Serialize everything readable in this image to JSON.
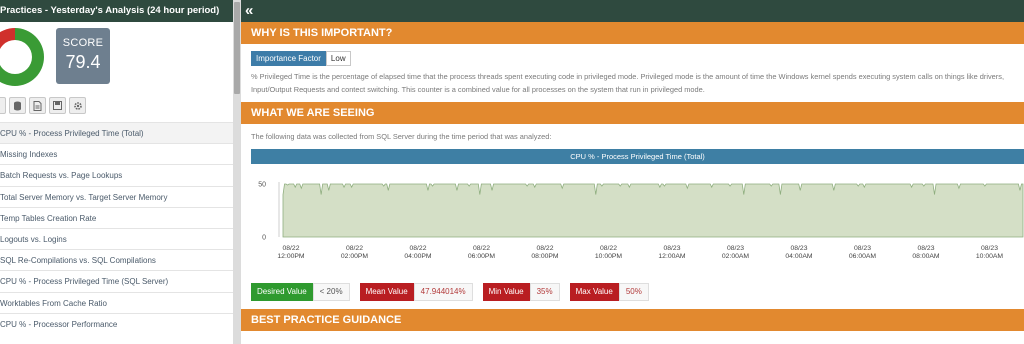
{
  "left_panel": {
    "header": "Practices - Yesterday's Analysis (24 hour period)",
    "score_label": "SCORE",
    "score_value": "79.4",
    "donut_colors": [
      "#3a9b35",
      "#e6b800",
      "#d0302c"
    ],
    "toolbar_icons": [
      "list-icon",
      "database-icon",
      "document-icon",
      "save-icon",
      "gear-icon"
    ],
    "practices": [
      "CPU % - Process Privileged Time (Total)",
      "Missing Indexes",
      "Batch Requests vs. Page Lookups",
      "Total Server Memory vs. Target Server Memory",
      "Temp Tables Creation Rate",
      "Logouts vs. Logins",
      "SQL Re-Compilations vs. SQL Compilations",
      "CPU % - Process Privileged Time (SQL Server)",
      "Worktables From Cache Ratio",
      "CPU % - Processor Performance"
    ]
  },
  "right_panel": {
    "why_header": "WHY IS THIS IMPORTANT?",
    "importance_label": "Importance Factor",
    "importance_value": "Low",
    "why_text": "% Privileged Time is the percentage of elapsed time that the process threads spent executing code in privileged mode. Privileged mode is the amount of time the Windows kernel spends executing system calls on things like drivers, Input/Output Requests and contect switching. This counter is a combined value for all processes on the system that run in privileged mode.",
    "see_header": "WHAT WE ARE SEEING",
    "see_text": "The following data was collected from SQL Server during the time period that was analyzed:",
    "guidance_header": "BEST PRACTICE GUIDANCE",
    "summary": {
      "desired_label": "Desired Value",
      "desired_value": "< 20%",
      "mean_label": "Mean Value",
      "mean_value": "47.944014%",
      "min_label": "Min Value",
      "min_value": "35%",
      "max_label": "Max Value",
      "max_value": "50%"
    },
    "colors": {
      "section_orange": "#e2892f",
      "header_dark": "#2f4a3f",
      "chart_title_blue": "#3e7fa4",
      "chart_fill": "#d4dfc6",
      "chart_line": "#8fae7f",
      "desired_green": "#2f9a2f",
      "stat_red": "#b91e22"
    }
  },
  "chart_data": {
    "type": "area",
    "title": "CPU % - Process Privileged Time (Total)",
    "y_ticks": [
      "50",
      "0"
    ],
    "ylim": [
      0,
      50
    ],
    "x_tick_labels": [
      {
        "d": "08/22",
        "t": "12:00PM"
      },
      {
        "d": "08/22",
        "t": "02:00PM"
      },
      {
        "d": "08/22",
        "t": "04:00PM"
      },
      {
        "d": "08/22",
        "t": "06:00PM"
      },
      {
        "d": "08/22",
        "t": "08:00PM"
      },
      {
        "d": "08/22",
        "t": "10:00PM"
      },
      {
        "d": "08/23",
        "t": "12:00AM"
      },
      {
        "d": "08/23",
        "t": "02:00AM"
      },
      {
        "d": "08/23",
        "t": "04:00AM"
      },
      {
        "d": "08/23",
        "t": "06:00AM"
      },
      {
        "d": "08/23",
        "t": "08:00AM"
      },
      {
        "d": "08/23",
        "t": "10:00AM"
      }
    ],
    "values": [
      40,
      50,
      50,
      49,
      50,
      50,
      50,
      50,
      47,
      50,
      50,
      50,
      46,
      50,
      50,
      50,
      50,
      50,
      50,
      50,
      50,
      50,
      50,
      50,
      50,
      40,
      50,
      50,
      50,
      50,
      44,
      50,
      50,
      50,
      50,
      50,
      50,
      50,
      50,
      50,
      47,
      50,
      50,
      50,
      50,
      47,
      50,
      50,
      50,
      50,
      50,
      50,
      50,
      50,
      50,
      50,
      50,
      50,
      50,
      50,
      50,
      50,
      50,
      50,
      50,
      50,
      48,
      50,
      50,
      44,
      50,
      50,
      50,
      50,
      50,
      50,
      50,
      50,
      50,
      50,
      50,
      50,
      50,
      50,
      50,
      50,
      50,
      50,
      50,
      50,
      50,
      50,
      50,
      50,
      50,
      44,
      50,
      50,
      48,
      50,
      50,
      50,
      50,
      50,
      50,
      50,
      50,
      50,
      50,
      50,
      50,
      50,
      50,
      50,
      44,
      50,
      50,
      50,
      50,
      50,
      50,
      50,
      48,
      50,
      50,
      50,
      50,
      50,
      50,
      40,
      50,
      50,
      50,
      50,
      50,
      50,
      50,
      44,
      50,
      50,
      50,
      50,
      50,
      50,
      50,
      50,
      50,
      50,
      50,
      50,
      50,
      50,
      50,
      50,
      50,
      50,
      50,
      50,
      50,
      50,
      48,
      50,
      50,
      50,
      50,
      47,
      50,
      50,
      50,
      50,
      50,
      50,
      50,
      50,
      50,
      50,
      50,
      50,
      50,
      50,
      50,
      50,
      50,
      46,
      50,
      50,
      50,
      50,
      50,
      50,
      50,
      50,
      50,
      50,
      50,
      50,
      50,
      50,
      50,
      50,
      50,
      50,
      50,
      50,
      50,
      40,
      50,
      50,
      50,
      48,
      50,
      50,
      50,
      50,
      50,
      50,
      50,
      50,
      50,
      50,
      50,
      48,
      50,
      50,
      50,
      50,
      50,
      47,
      50,
      50,
      50,
      50,
      50,
      50,
      50,
      50,
      50,
      50,
      50,
      50,
      50,
      50,
      50,
      50,
      50,
      50,
      50,
      47,
      50,
      50,
      48,
      50,
      50,
      50,
      50,
      50,
      50,
      50,
      50,
      50,
      50,
      50,
      50,
      50,
      50,
      46,
      50,
      50,
      50,
      50,
      50,
      50,
      50,
      50,
      50,
      50,
      50,
      50,
      50,
      50,
      50,
      47,
      50,
      50,
      50,
      50,
      50,
      50,
      50,
      50,
      50,
      50,
      50,
      48,
      50,
      50,
      50,
      50,
      50,
      50,
      50,
      50,
      40,
      50,
      50,
      50,
      50,
      50,
      50,
      50,
      50,
      50,
      50,
      50,
      50,
      50,
      50,
      50,
      50,
      50,
      48,
      50,
      50,
      50,
      50,
      50,
      40,
      50,
      50,
      50,
      50,
      50,
      50,
      50,
      50,
      50,
      50,
      50,
      50,
      44,
      50,
      50,
      50,
      50,
      50,
      50,
      50,
      50,
      50,
      50,
      50,
      50,
      50,
      50,
      50,
      50,
      50,
      50,
      50,
      50,
      50,
      44,
      50,
      50,
      50,
      50,
      50,
      50,
      50,
      50,
      50,
      50,
      50,
      50,
      50,
      50,
      50,
      48,
      50,
      50,
      50,
      47,
      50,
      50,
      50,
      50,
      50,
      50,
      50,
      50,
      50,
      50,
      50,
      50,
      50,
      50,
      50,
      50,
      50,
      50,
      50,
      50,
      50,
      50,
      50,
      50,
      50,
      50,
      50,
      50,
      50,
      50,
      47,
      50,
      50,
      50,
      50,
      50,
      50,
      50,
      48,
      50,
      50,
      50,
      50,
      50,
      50,
      40,
      50,
      50,
      50,
      50,
      50,
      50,
      50,
      50,
      50,
      50,
      50,
      50,
      50,
      50,
      50,
      46,
      50,
      50,
      50,
      50,
      50,
      50,
      50,
      50,
      50,
      50,
      50,
      50,
      50,
      50,
      50,
      50,
      48,
      50,
      50,
      50,
      50,
      50,
      50,
      50,
      50,
      50,
      50,
      50,
      50,
      50,
      50,
      50,
      50,
      50,
      50,
      50,
      50,
      50,
      50,
      44,
      50,
      50
    ]
  }
}
